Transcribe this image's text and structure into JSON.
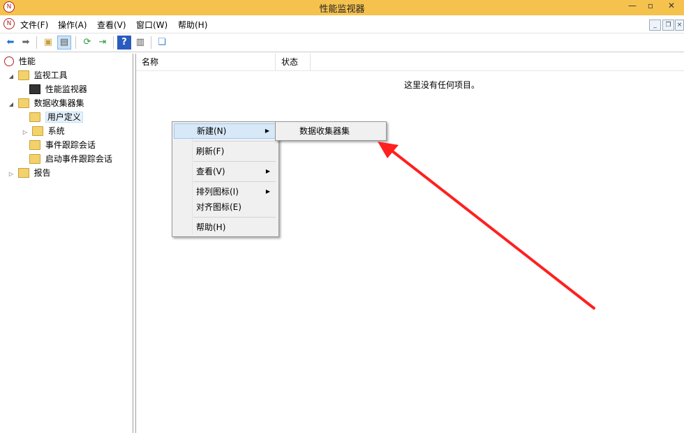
{
  "window": {
    "title": "性能监视器"
  },
  "menubar": {
    "items": [
      "文件(F)",
      "操作(A)",
      "查看(V)",
      "窗口(W)",
      "帮助(H)"
    ]
  },
  "toolbar": {
    "buttons": [
      "back-icon",
      "forward-icon",
      "up-folder-icon",
      "show-hide-tree-icon",
      "refresh-icon",
      "export-list-icon",
      "help-icon",
      "properties-icon",
      "new-window-icon"
    ]
  },
  "tree": {
    "root": "性能",
    "items": [
      {
        "label": "监视工具",
        "icon": "folder-icon"
      },
      {
        "label": "性能监视器",
        "icon": "monitor-icon"
      },
      {
        "label": "数据收集器集",
        "icon": "folder-icon"
      },
      {
        "label": "用户定义",
        "icon": "user-defined-icon"
      },
      {
        "label": "系统",
        "icon": "folder-icon"
      },
      {
        "label": "事件跟踪会话",
        "icon": "folder-icon"
      },
      {
        "label": "启动事件跟踪会话",
        "icon": "folder-icon"
      },
      {
        "label": "报告",
        "icon": "report-icon"
      }
    ]
  },
  "list": {
    "columns": [
      "名称",
      "状态"
    ],
    "empty_message": "这里没有任何项目。"
  },
  "context_menu": {
    "items": [
      "新建(N)",
      "刷新(F)",
      "查看(V)",
      "排列图标(I)",
      "对齐图标(E)",
      "帮助(H)"
    ]
  },
  "submenu": {
    "items": [
      "数据收集器集"
    ]
  },
  "colors": {
    "titlebar": "#f5c24e",
    "highlight": "#d7e8f9",
    "annotation_arrow": "#ff2020"
  }
}
